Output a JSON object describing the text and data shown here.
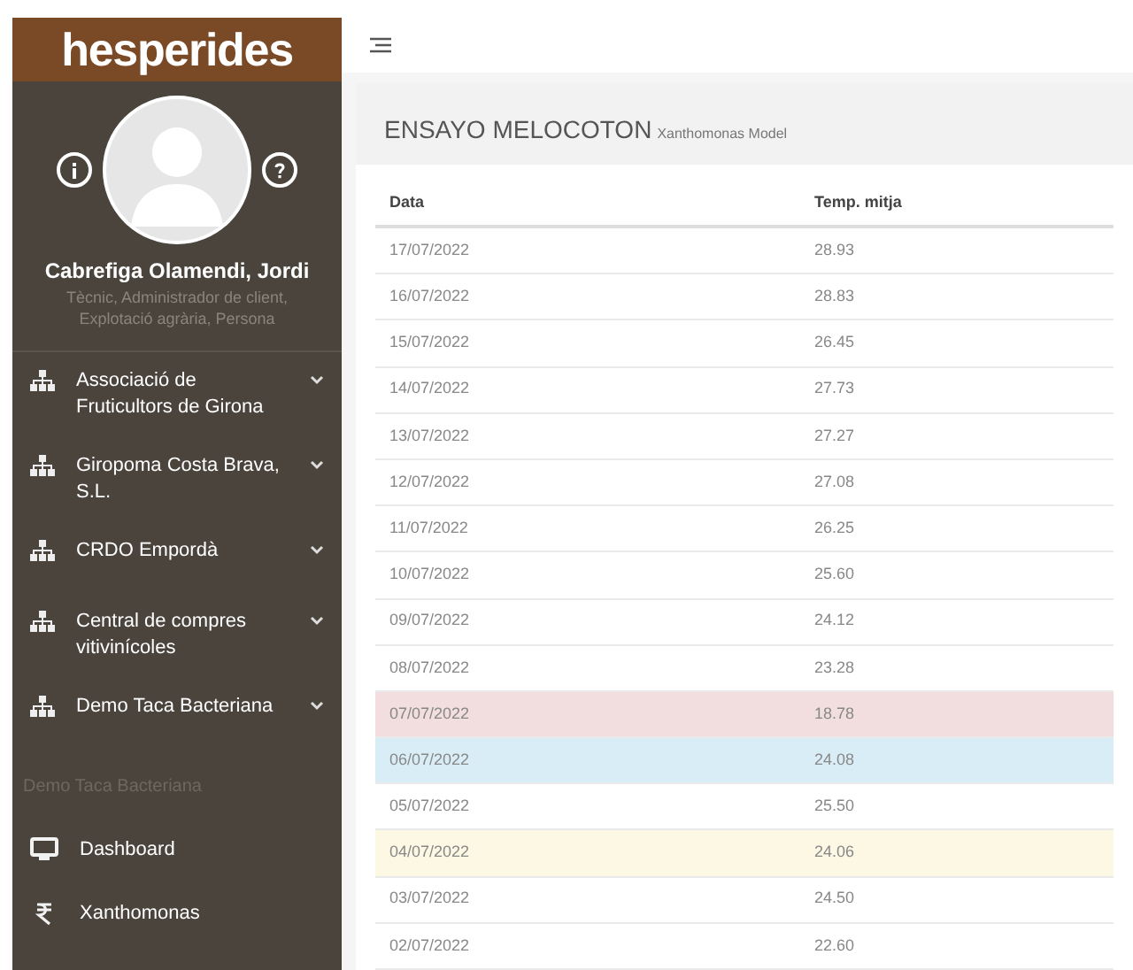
{
  "logo": "hesperides",
  "profile": {
    "name": "Cabrefiga Olamendi, Jordi",
    "roles": "Tècnic, Administrador de client, Explotació agrària, Persona"
  },
  "sidebar": {
    "groups": [
      {
        "label": "Associació de Fruticultors de Girona"
      },
      {
        "label": "Giropoma Costa Brava, S.L."
      },
      {
        "label": "CRDO Empordà"
      },
      {
        "label": "Central de compres vitivinícoles"
      },
      {
        "label": "Demo Taca Bacteriana"
      }
    ],
    "section": "Demo Taca Bacteriana",
    "items": [
      {
        "kind": "monitor",
        "label": "Dashboard"
      },
      {
        "kind": "rupee",
        "label": "Xanthomonas"
      }
    ]
  },
  "panel": {
    "title": "ENSAYO MELOCOTON",
    "subtitle": "Xanthomonas Model"
  },
  "table": {
    "columns": [
      "Data",
      "Temp. mitja"
    ],
    "rows": [
      {
        "cells": [
          "17/07/2022",
          "28.93"
        ]
      },
      {
        "cells": [
          "16/07/2022",
          "28.83"
        ]
      },
      {
        "cells": [
          "15/07/2022",
          "26.45"
        ]
      },
      {
        "cells": [
          "14/07/2022",
          "27.73"
        ]
      },
      {
        "cells": [
          "13/07/2022",
          "27.27"
        ]
      },
      {
        "cells": [
          "12/07/2022",
          "27.08"
        ]
      },
      {
        "cells": [
          "11/07/2022",
          "26.25"
        ]
      },
      {
        "cells": [
          "10/07/2022",
          "25.60"
        ]
      },
      {
        "cells": [
          "09/07/2022",
          "24.12"
        ]
      },
      {
        "cells": [
          "08/07/2022",
          "23.28"
        ]
      },
      {
        "cells": [
          "07/07/2022",
          "18.78"
        ],
        "color": "#f2dede"
      },
      {
        "cells": [
          "06/07/2022",
          "24.08"
        ],
        "color": "#d9edf7"
      },
      {
        "cells": [
          "05/07/2022",
          "25.50"
        ]
      },
      {
        "cells": [
          "04/07/2022",
          "24.06"
        ],
        "color": "#fcf8e3"
      },
      {
        "cells": [
          "03/07/2022",
          "24.50"
        ]
      },
      {
        "cells": [
          "02/07/2022",
          "22.60"
        ]
      }
    ]
  }
}
